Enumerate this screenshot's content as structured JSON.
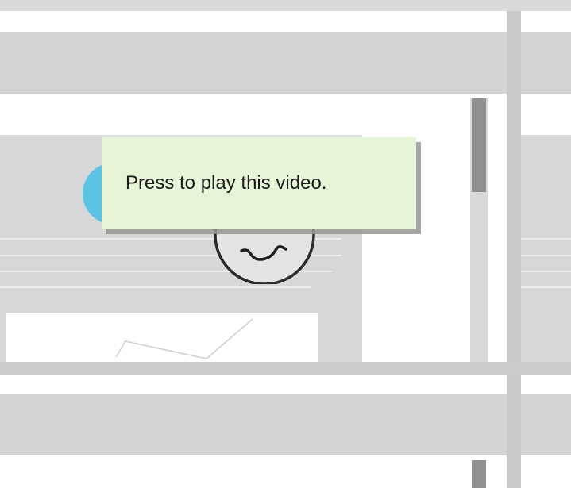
{
  "tooltip": {
    "text": "Press to play this video."
  },
  "icons": {
    "video": "pen-signature-icon",
    "avatar": "avatar"
  },
  "colors": {
    "tooltip_background": "#e6f4d7",
    "avatar_blue": "#5bc4e2",
    "wireframe_gray": "#d3d4d6",
    "scroll_thumb": "#8f9092"
  },
  "scrollbar": {
    "position": 0.0
  }
}
